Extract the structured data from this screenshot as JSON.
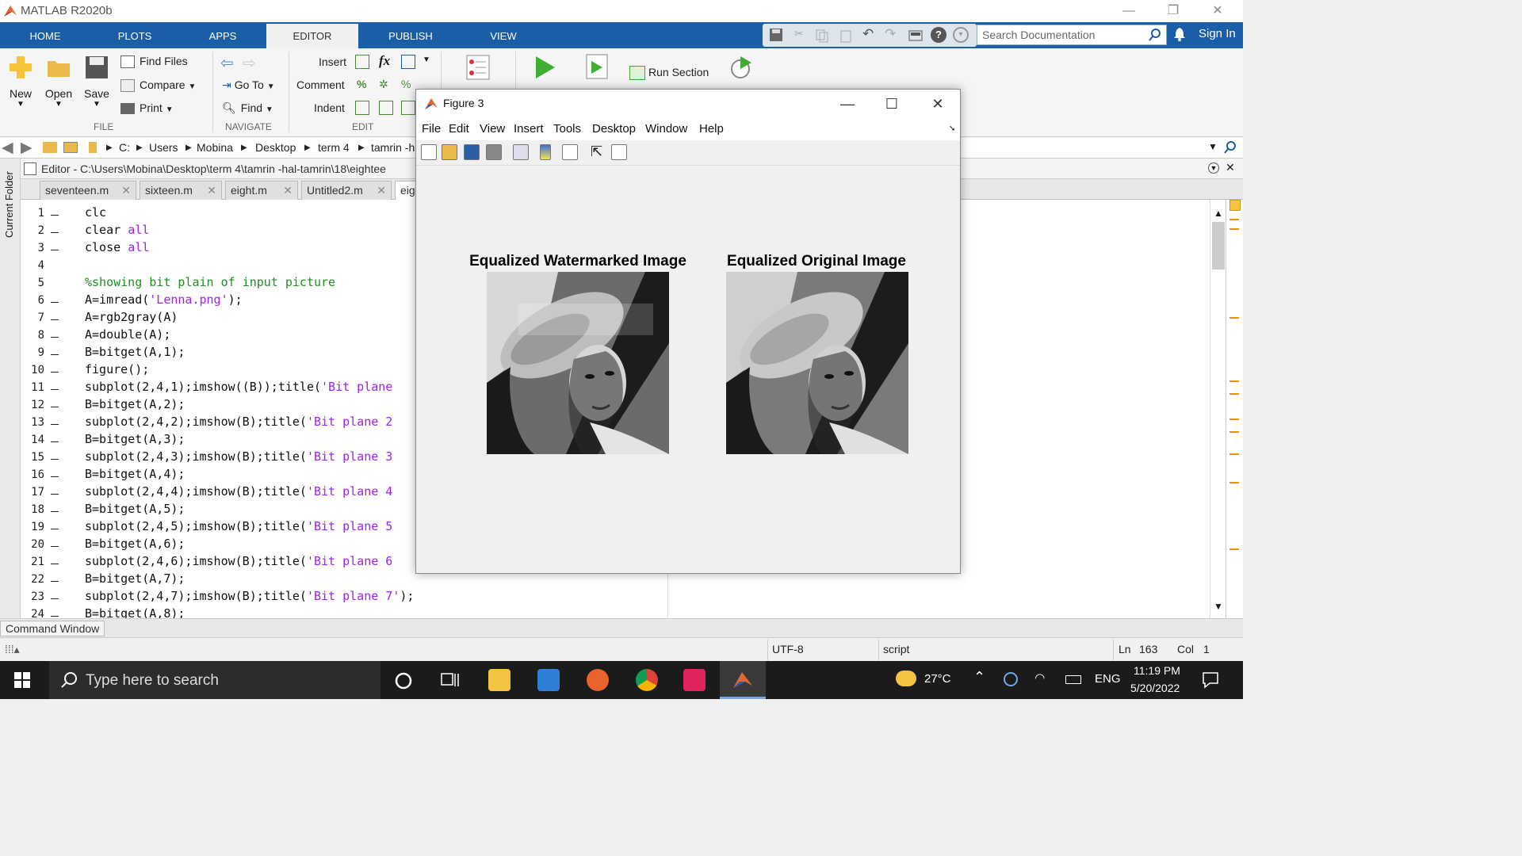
{
  "app": {
    "title": "MATLAB R2020b",
    "window_controls": [
      "—",
      "❐",
      "✕"
    ]
  },
  "ribbon_tabs": [
    "HOME",
    "PLOTS",
    "APPS",
    "EDITOR",
    "PUBLISH",
    "VIEW"
  ],
  "search": {
    "placeholder": "Search Documentation"
  },
  "sign_in": "Sign In",
  "ribbon": {
    "file": {
      "new": "New",
      "open": "Open",
      "save": "Save",
      "find_files": "Find Files",
      "compare": "Compare",
      "print": "Print",
      "label": "FILE"
    },
    "navigate": {
      "go_to": "Go To",
      "find": "Find",
      "label": "NAVIGATE"
    },
    "edit": {
      "insert": "Insert",
      "comment": "Comment",
      "indent": "Indent",
      "fx": "fx",
      "label": "EDIT"
    },
    "run": {
      "run_section": "Run Section"
    }
  },
  "address": [
    "C:",
    "Users",
    "Mobina",
    "Desktop",
    "term 4",
    "tamrin -h"
  ],
  "side_panel": "Current Folder",
  "editor": {
    "title": "Editor - C:\\Users\\Mobina\\Desktop\\term 4\\tamrin -hal-tamrin\\18\\eightee",
    "tabs": [
      "seventeen.m",
      "sixteen.m",
      "eight.m",
      "Untitled2.m",
      "eig"
    ],
    "line_numbers": [
      "1",
      "2",
      "3",
      "4",
      "5",
      "6",
      "7",
      "8",
      "9",
      "10",
      "11",
      "12",
      "13",
      "14",
      "15",
      "16",
      "17",
      "18",
      "19",
      "20",
      "21",
      "22",
      "23",
      "24"
    ]
  },
  "code": [
    [
      [
        "clc",
        ""
      ]
    ],
    [
      [
        "clear ",
        ""
      ],
      [
        "all",
        "kw"
      ]
    ],
    [
      [
        "close ",
        ""
      ],
      [
        "all",
        "kw"
      ]
    ],
    [],
    [
      [
        "%showing bit plain of input picture",
        "cm"
      ]
    ],
    [
      [
        "A=imread(",
        ""
      ],
      [
        "'Lenna.png'",
        "str"
      ],
      [
        ");",
        ""
      ]
    ],
    [
      [
        "A=rgb2gray(A)",
        ""
      ]
    ],
    [
      [
        "A=double(A);",
        ""
      ]
    ],
    [
      [
        "B=bitget(A,1);",
        ""
      ]
    ],
    [
      [
        "figure();",
        ""
      ]
    ],
    [
      [
        "subplot(2,4,1);imshow((B));title(",
        ""
      ],
      [
        "'Bit plane",
        "str"
      ]
    ],
    [
      [
        "B=bitget(A,2);",
        ""
      ]
    ],
    [
      [
        "subplot(2,4,2);imshow(B);title(",
        ""
      ],
      [
        "'Bit plane 2",
        "str"
      ]
    ],
    [
      [
        "B=bitget(A,3);",
        ""
      ]
    ],
    [
      [
        "subplot(2,4,3);imshow(B);title(",
        ""
      ],
      [
        "'Bit plane 3",
        "str"
      ]
    ],
    [
      [
        "B=bitget(A,4);",
        ""
      ]
    ],
    [
      [
        "subplot(2,4,4);imshow(B);title(",
        ""
      ],
      [
        "'Bit plane 4",
        "str"
      ]
    ],
    [
      [
        "B=bitget(A,5);",
        ""
      ]
    ],
    [
      [
        "subplot(2,4,5);imshow(B);title(",
        ""
      ],
      [
        "'Bit plane 5",
        "str"
      ]
    ],
    [
      [
        "B=bitget(A,6);",
        ""
      ]
    ],
    [
      [
        "subplot(2,4,6);imshow(B);title(",
        ""
      ],
      [
        "'Bit plane 6",
        "str"
      ]
    ],
    [
      [
        "B=bitget(A,7);",
        ""
      ]
    ],
    [
      [
        "subplot(2,4,7);imshow(B);title(",
        ""
      ],
      [
        "'Bit plane 7'",
        "str"
      ],
      [
        ");",
        ""
      ]
    ],
    [
      [
        "B=bitget(A,8);",
        ""
      ]
    ]
  ],
  "command_window": "Command Window",
  "status": {
    "encoding": "UTF-8",
    "type": "script",
    "ln_label": "Ln",
    "ln": "163",
    "col_label": "Col",
    "col": "1"
  },
  "figure": {
    "title": "Figure 3",
    "menu": [
      "File",
      "Edit",
      "View",
      "Insert",
      "Tools",
      "Desktop",
      "Window",
      "Help"
    ],
    "left_title": "Equalized Watermarked Image",
    "right_title": "Equalized Original Image"
  },
  "taskbar": {
    "search_placeholder": "Type here to search",
    "temperature": "27°C",
    "language": "ENG",
    "time": "11:19 PM",
    "date": "5/20/2022"
  },
  "colors": {
    "ribbon_blue": "#1a5ea8",
    "taskbar": "#1b1b1b",
    "comment": "#228b22",
    "keyword": "#a020f0"
  }
}
